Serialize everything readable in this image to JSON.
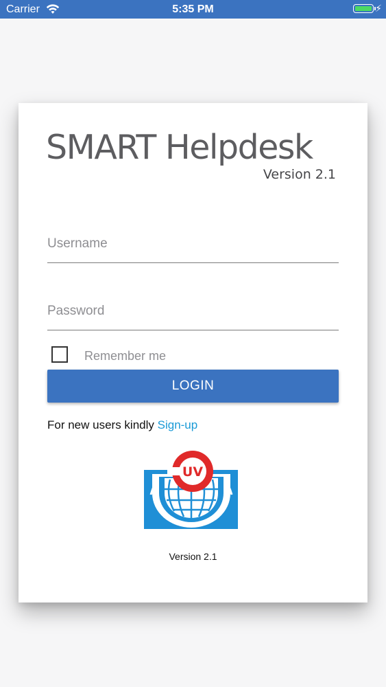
{
  "status_bar": {
    "carrier": "Carrier",
    "time": "5:35 PM",
    "wifi_icon": "wifi-icon",
    "battery_icon": "battery-icon",
    "charging_icon": "charging-bolt-icon"
  },
  "brand": {
    "title": "SMART Helpdesk",
    "version": "Version 2.1"
  },
  "form": {
    "username": {
      "placeholder": "Username",
      "value": ""
    },
    "password": {
      "placeholder": "Password",
      "value": ""
    },
    "remember_label": "Remember me",
    "remember_checked": false,
    "login_label": "LOGIN"
  },
  "signup": {
    "prompt": "For new users kindly ",
    "link_label": "Sign-up"
  },
  "logo": {
    "text": "UV",
    "icon": "uv-globe-logo"
  },
  "footer": {
    "version": "Version 2.1"
  },
  "colors": {
    "primary": "#3b73c0",
    "link": "#1a9ad6",
    "logo_red": "#e02a2a",
    "logo_blue": "#1f8fd6"
  }
}
